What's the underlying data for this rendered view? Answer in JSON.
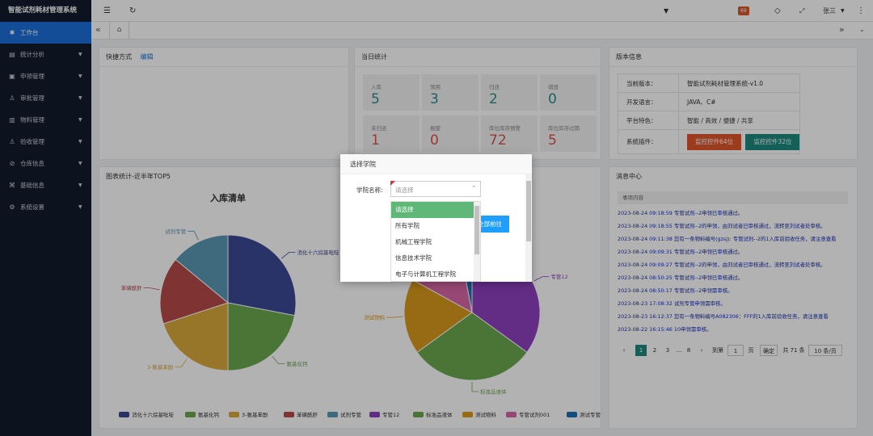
{
  "app": {
    "title": "智能试剂耗材管理系统"
  },
  "sidebar": {
    "items": [
      {
        "icon": "✱",
        "label": "工作台"
      },
      {
        "icon": "▤",
        "label": "统计分析"
      },
      {
        "icon": "▣",
        "label": "申领管理"
      },
      {
        "icon": "♙",
        "label": "审批管理"
      },
      {
        "icon": "▥",
        "label": "物料管理"
      },
      {
        "icon": "♙",
        "label": "验收管理"
      },
      {
        "icon": "⊘",
        "label": "仓库信息"
      },
      {
        "icon": "⌘",
        "label": "基础信息"
      },
      {
        "icon": "⚙",
        "label": "系统设置"
      }
    ]
  },
  "topbar": {
    "badge": "69",
    "user": "张三"
  },
  "quick": {
    "title": "快捷方式",
    "edit": "编辑"
  },
  "today": {
    "title": "当日统计",
    "stats": [
      {
        "label": "入库",
        "value": "5",
        "color": "#2e8b8b"
      },
      {
        "label": "领用",
        "value": "3",
        "color": "#2e8b8b"
      },
      {
        "label": "归还",
        "value": "2",
        "color": "#2e8b8b"
      },
      {
        "label": "销毁",
        "value": "0",
        "color": "#2e8b8b"
      },
      {
        "label": "未归还",
        "value": "1",
        "color": "#d9534f"
      },
      {
        "label": "报废",
        "value": "0",
        "color": "#d9534f"
      },
      {
        "label": "库位库存预警",
        "value": "72",
        "color": "#d9534f"
      },
      {
        "label": "库位库存过期",
        "value": "5",
        "color": "#d9534f"
      }
    ]
  },
  "version": {
    "title": "版本信息",
    "rows": [
      {
        "k": "当前版本：",
        "v": "智能试剂耗材管理系统-v1.0"
      },
      {
        "k": "开发语言：",
        "v": "JAVA、C#"
      },
      {
        "k": "平台特色：",
        "v": "智能 / 高效 / 便捷 / 共享"
      },
      {
        "k": "系统插件：",
        "v": ""
      }
    ],
    "btn64": "监控控件64位",
    "btn32": "监控控件32位"
  },
  "chart_panel": {
    "title": "图表统计-近半年TOP5"
  },
  "messages": {
    "title": "消息中心",
    "header": "事项内容",
    "items": [
      "2023-08-24 09:18:59 专管试剂--2申领已审核通过。",
      "2023-08-24 09:18:55 专管试剂--2的申领，由刘试者已审核通过，流转至刘试者处审核。",
      "2023-08-24 09:11:38 您有一条物料编号(gzsj): 专管试剂--2的1入库前验收任务，请注意查看",
      "2023-08-24 09:09:31 专管试剂--2申领已审核通过。",
      "2023-08-24 09:09:27 专管试剂--2的申领，由刘试者已审核通过，流转至刘试者处审核。",
      "2023-08-24 08:50:25 专管试剂--2申领已审核通过。",
      "2023-08-24 08:50:17 专管试剂--2申领需审核。",
      "2023-08-23 17:08:32 试剂专管申领需审核。",
      "2023-08-23 16:12:37 您有一条物料编号A082306：FFF的1入库前验收任务，请注意查看",
      "2023-08-22 16:15:46 10申领需审核。"
    ],
    "pager": {
      "p1": "1",
      "p2": "2",
      "p3": "3",
      "dots": "...",
      "p8": "8",
      "goto": "到第",
      "page_input": "1",
      "page_unit": "页",
      "confirm": "确定",
      "total": "共 71 条",
      "size": "10 条/页"
    }
  },
  "chart_data": [
    {
      "type": "pie",
      "title": "入库清单",
      "series": [
        {
          "name": "消化十六烷基吡啶",
          "value": 28,
          "color": "#3b4a94"
        },
        {
          "name": "氨基化钙",
          "value": 22,
          "color": "#6aa84f"
        },
        {
          "name": "3-氨基苯酚",
          "value": 20,
          "color": "#d9a93d"
        },
        {
          "name": "苯磺酰肝",
          "value": 16,
          "color": "#b84a4a"
        },
        {
          "name": "试剂专管",
          "value": 14,
          "color": "#5b97b3"
        }
      ]
    },
    {
      "type": "pie",
      "title": "",
      "series": [
        {
          "name": "专管12",
          "value": 35,
          "color": "#8e3fbf"
        },
        {
          "name": "标准品液体",
          "value": 30,
          "color": "#6aa84f"
        },
        {
          "name": "测试物料",
          "value": 18,
          "color": "#d99a1c"
        },
        {
          "name": "专管试剂001",
          "value": 14,
          "color": "#d966a5"
        },
        {
          "name": "测试专管",
          "value": 3,
          "color": "#1a6fb0"
        }
      ]
    }
  ],
  "dialog": {
    "title": "选择学院",
    "field_label": "学院名称:",
    "placeholder": "请选择",
    "go": "全部前往",
    "options": [
      "请选择",
      "所有学院",
      "机械工程学院",
      "信息技术学院",
      "电子与计算机工程学院"
    ]
  },
  "colors": {
    "sidebar": "#141c2b",
    "active": "#1e6fd9",
    "teal": "#1e8a7e",
    "orange": "#e0572b",
    "option_selected": "#5fb878"
  }
}
